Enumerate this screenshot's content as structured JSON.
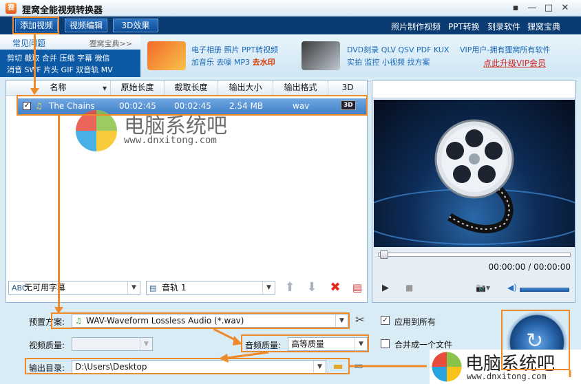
{
  "window": {
    "title": "狸窝全能视频转换器",
    "min": "▪",
    "restore": "—",
    "max": "□",
    "close": "✕"
  },
  "toolbar": {
    "add_video": "添加视频",
    "edit_video": "视频编辑",
    "effect_3d": "3D效果",
    "links": [
      "照片制作视频",
      "PPT转换",
      "刻录软件",
      "狸窝宝典"
    ]
  },
  "faq": {
    "title": "常见问题",
    "more": "狸窝宝典>>",
    "line1": "剪切 截取 合并 压缩 字幕 微信",
    "line2": "消音 SWF 片头 GIF 双音轨 MV"
  },
  "promo1": {
    "line1": "电子相册 照片 PPT转视频",
    "line2a": "加音乐 去噪 MP3 ",
    "line2b": "去水印"
  },
  "promo2": {
    "line1": "DVD刻录 QLV QSV PDF KUX",
    "line2": "实拍 监控 小视频 找方案"
  },
  "vip": {
    "line1": "VIP用户-拥有狸窝所有软件",
    "link": "点此升级VIP会员"
  },
  "table": {
    "headers": [
      "名称",
      "原始长度",
      "截取长度",
      "输出大小",
      "输出格式",
      "3D"
    ],
    "rows": [
      {
        "checked": "✓",
        "name": "The Chains",
        "orig": "00:02:45",
        "clip": "00:02:45",
        "size": "2.54 MB",
        "format": "wav",
        "badge": "3D"
      }
    ]
  },
  "listbar": {
    "subtitle": "无可用字幕",
    "audio_track": "音轨 1",
    "subtitle_icon": "ABC"
  },
  "preview": {
    "time": "00:00:00 / 00:00:00"
  },
  "settings": {
    "preset_label": "预置方案:",
    "preset_value": "WAV-Waveform Lossless Audio (*.wav)",
    "apply_all": "应用到所有",
    "video_quality_label": "视频质量:",
    "audio_quality_label": "音频质量:",
    "audio_quality_value": "高等质量",
    "merge": "合并成一个文件",
    "output_label": "输出目录:",
    "output_value": "D:\\Users\\Desktop"
  },
  "watermark": {
    "text": "电脑系统吧",
    "url": "www.dnxitong.com"
  },
  "colors": {
    "accent": "#ef8a2a",
    "toolbar": "#0a3b73",
    "selection": "#3f7fc7"
  }
}
